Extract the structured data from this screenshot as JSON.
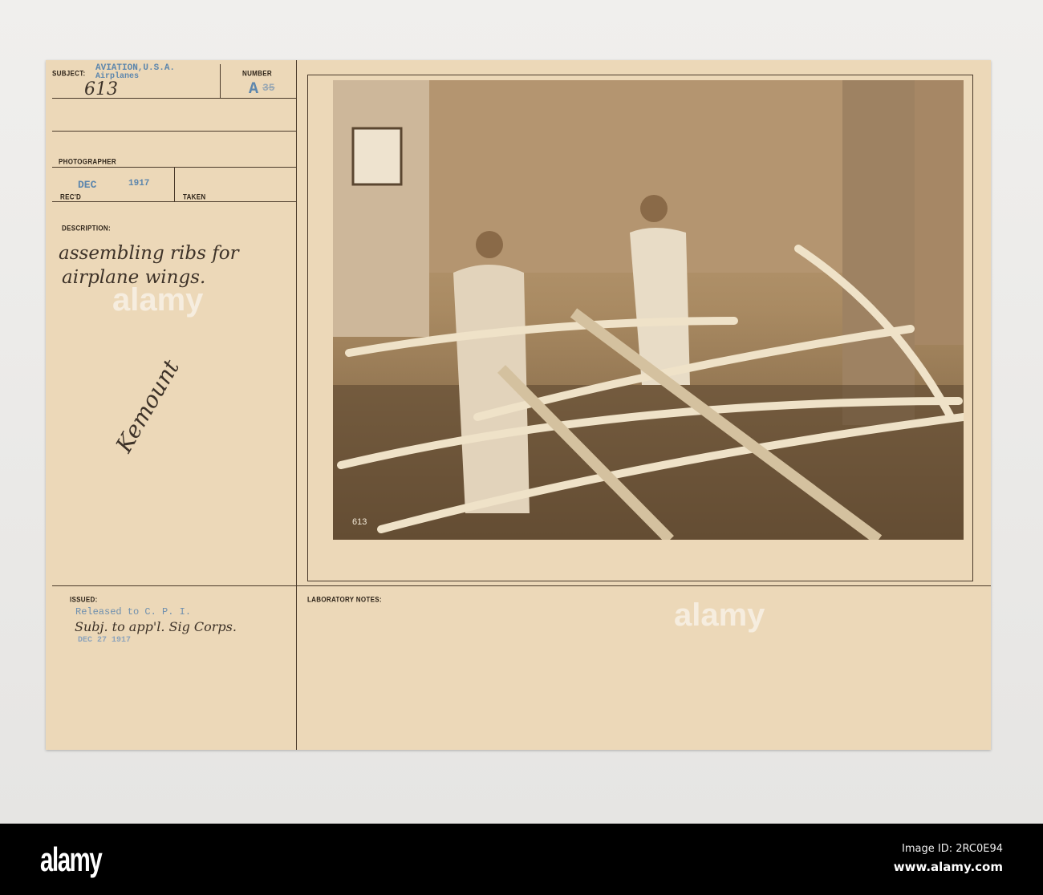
{
  "card": {
    "subject_label": "SUBJECT:",
    "subject_stamp_1": "AVIATION,U.S.A.",
    "subject_stamp_2": "Airplanes",
    "subject_handwritten": "613",
    "number_label": "NUMBER",
    "number_value": "A",
    "number_struck": "35",
    "photographer_label": "PHOTOGRAPHER",
    "recd_label": "REC'D",
    "recd_stamp_month": "DEC",
    "recd_stamp_year": "1917",
    "taken_label": "TAKEN",
    "description_label": "DESCRIPTION:",
    "description_line_1": "assembling ribs for",
    "description_line_2": "airplane wings.",
    "signature": "Kemount",
    "issued_label": "ISSUED:",
    "issued_stamp": "Released to C. P. I.",
    "issued_handwritten": "Subj. to app'l. Sig Corps.",
    "issued_date": "DEC 27 1917",
    "lab_notes_label": "LABORATORY NOTES:",
    "photo_number": "613"
  },
  "footer": {
    "logo": "alamy",
    "image_id": "Image ID: 2RC0E94",
    "site": "www.alamy.com",
    "watermark": "alamy"
  }
}
